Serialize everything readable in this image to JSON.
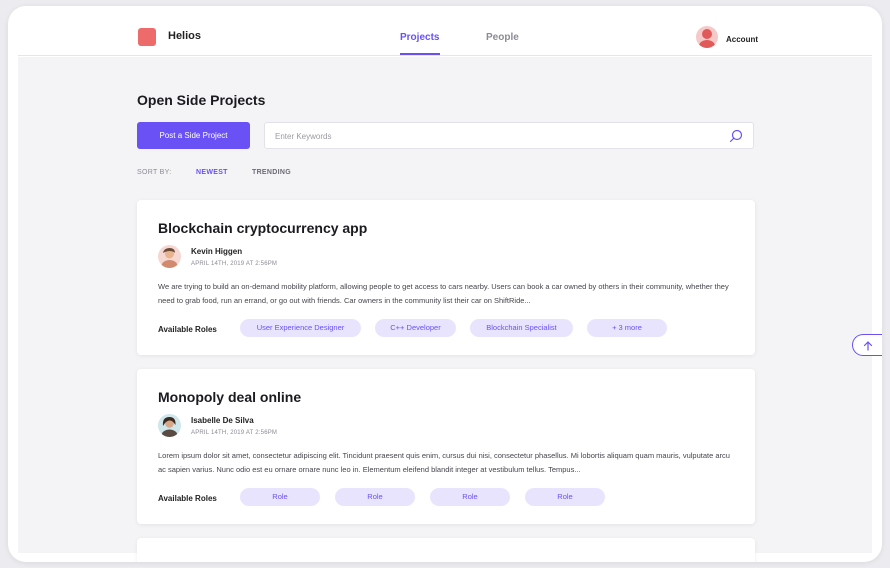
{
  "header": {
    "brand": "Helios",
    "tabs": [
      {
        "label": "Projects",
        "active": true
      },
      {
        "label": "People",
        "active": false
      }
    ],
    "account_label": "Account"
  },
  "main": {
    "title": "Open Side Projects",
    "post_button": "Post a Side Project",
    "search": {
      "placeholder": "Enter Keywords",
      "value": ""
    },
    "sort": {
      "label": "SORT BY:",
      "options": [
        {
          "label": "NEWEST",
          "active": true
        },
        {
          "label": "TRENDING",
          "active": false
        }
      ]
    },
    "projects": [
      {
        "title": "Blockchain cryptocurrency app",
        "author": "Kevin Higgen",
        "date": "APRIL 14TH, 2019 AT 2:56PM",
        "description": "We are trying to build an on-demand mobility platform, allowing people to get access to cars nearby. Users can book a car owned by others in their community, whether they need to grab food, run an errand, or go out with friends. Car owners in the community list their car on ShiftRide...",
        "roles_label": "Available Roles",
        "roles": [
          "User Experience Designer",
          "C++ Developer",
          "Blockchain Specialist",
          "+ 3 more"
        ]
      },
      {
        "title": "Monopoly deal online",
        "author": "Isabelle De Silva",
        "date": "APRIL 14TH, 2019 AT 2:56PM",
        "description": "Lorem ipsum dolor sit amet, consectetur adipiscing elit. Tincidunt praesent quis enim, cursus dui nisi, consectetur phasellus. Mi lobortis aliquam quam mauris, vulputate arcu ac sapien varius. Nunc odio est eu ornare ornare nunc leo in. Elementum eleifend blandit integer at vestibulum tellus. Tempus...",
        "roles_label": "Available Roles",
        "roles": [
          "Role",
          "Role",
          "Role",
          "Role"
        ]
      }
    ]
  },
  "colors": {
    "accent": "#6a51f5",
    "chip_bg": "#e9e4fd",
    "logo": "#ee6b6b",
    "background": "#f4f4f6"
  },
  "icons": [
    "search-icon",
    "arrow-up-icon",
    "user-avatar-icon"
  ]
}
